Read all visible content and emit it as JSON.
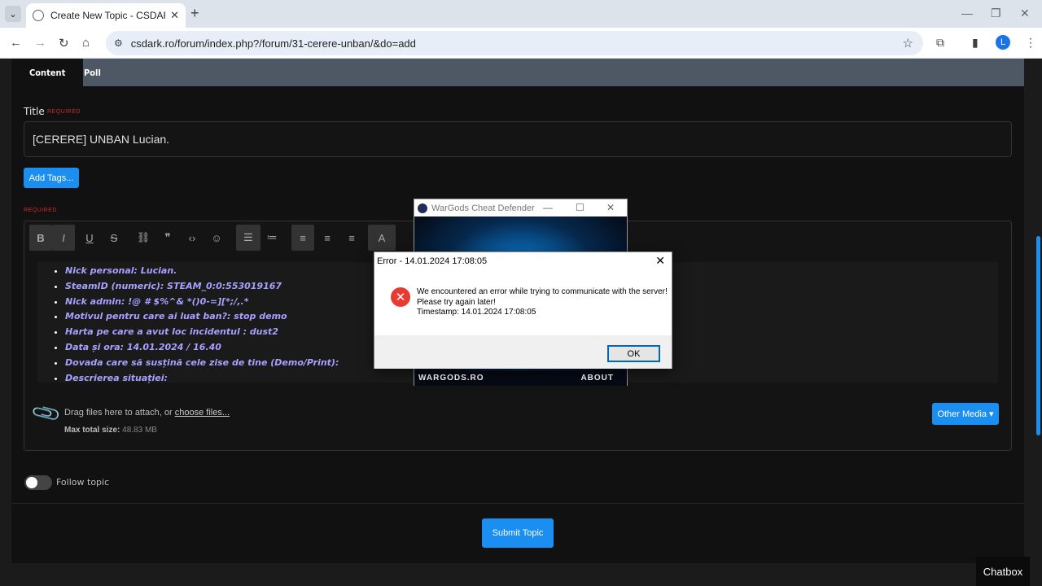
{
  "browser": {
    "tab_title": "Create New Topic - CSDARK - C",
    "url": "csdark.ro/forum/index.php?/forum/31-cerere-unban/&do=add",
    "profile_initial": "L"
  },
  "page": {
    "tabs": [
      {
        "label": "Content"
      },
      {
        "label": "Poll"
      }
    ],
    "title_label": "Title",
    "required_label": "REQUIRED",
    "title_value": "[CERERE] UNBAN Lucian.",
    "add_tags_label": "Add Tags...",
    "body_required_label": "REQUIRED",
    "editor_lines": [
      "Nick personal:  Lucian.",
      "SteamID (numeric): STEAM_0:0:553019167",
      "Nick admin: !@ # $%^& *()0-=][*;/,.*",
      "Motivul pentru care ai luat ban?: stop demo",
      "Harta pe care a avut loc incidentul : dust2",
      "Data și ora: 14.01.2024 / 16.40",
      "Dovada care să susțină cele zise de tine (Demo/Print):",
      "Descrierea situației:"
    ],
    "attach_text": "Drag files here to attach, or",
    "choose_files_label": "choose files...",
    "max_size_label": "Max total size:",
    "max_size_value": "48.83 MB",
    "other_media_label": "Other Media ▾",
    "follow_label": "Follow topic",
    "submit_label": "Submit Topic",
    "chatbox_label": "Chatbox"
  },
  "wargods": {
    "window_title": "WarGods Cheat Defender",
    "bottom_left": "WARGODS.RO",
    "bottom_right": "ABOUT"
  },
  "error_dialog": {
    "title": "Error - 14.01.2024 17:08:05",
    "line1": "We encountered an error while trying to communicate with the server!",
    "line2": "Please try again later!",
    "line3": "Timestamp: 14.01.2024 17:08:05",
    "ok_label": "OK"
  },
  "colors": {
    "accent": "#1b8ef2",
    "editor_text": "#a7a1ff",
    "required": "#d02a2a",
    "error_icon": "#e83a2f"
  }
}
